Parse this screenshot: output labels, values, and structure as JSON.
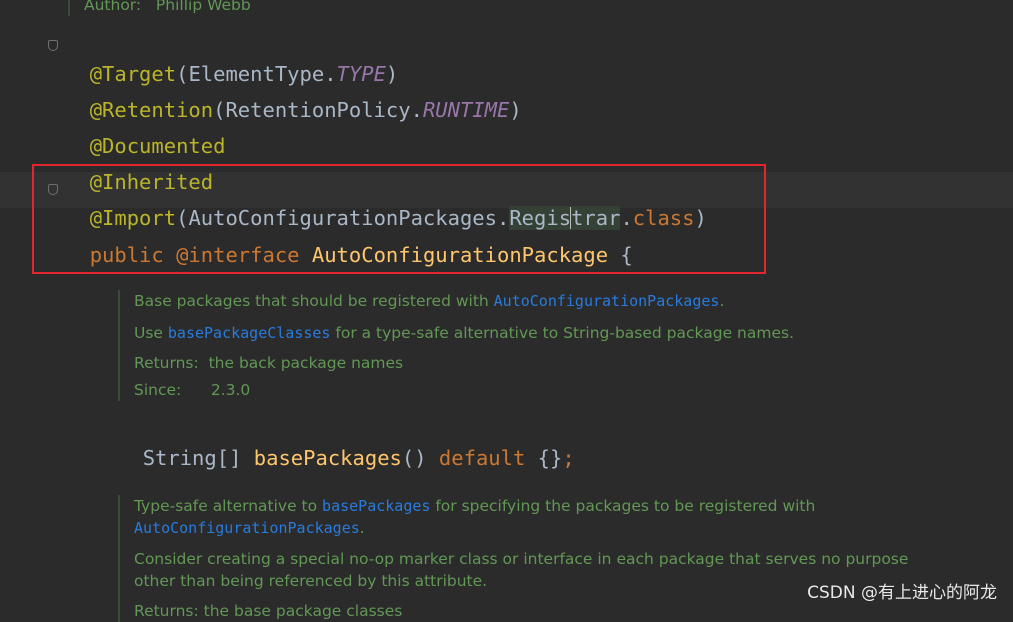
{
  "header_doc": {
    "author_label": "Author:",
    "author_value": "Phillip Webb"
  },
  "code": {
    "line1": {
      "annotation": "@Target",
      "open": "(",
      "class": "ElementType.",
      "const": "TYPE",
      "close": ")"
    },
    "line2": {
      "annotation": "@Retention",
      "open": "(",
      "class": "RetentionPolicy.",
      "const": "RUNTIME",
      "close": ")"
    },
    "line3": {
      "annotation": "@Documented"
    },
    "line4": {
      "annotation": "@Inherited"
    },
    "line5": {
      "annotation": "@Import",
      "open": "(",
      "class": "AutoConfigurationPackages.",
      "inner_a": "Regis",
      "inner_b": "trar",
      "dot": ".",
      "kw": "class",
      "close": ")"
    },
    "line6": {
      "kw1": "public ",
      "kw2": "@interface ",
      "name": "AutoConfigurationPackage",
      "brace": " {"
    },
    "method1": {
      "type": "String[] ",
      "name": "basePackages",
      "parens": "() ",
      "kw": "default",
      "rest": " {}",
      "semi": ";"
    }
  },
  "doc1": {
    "line1_text": "Base packages that should be registered with ",
    "line1_ref": "AutoConfigurationPackages",
    "line1_end": ".",
    "line2_pre": "Use ",
    "line2_ref": "basePackageClasses",
    "line2_post": " for a type-safe alternative to String-based package names.",
    "returns_label": "Returns:",
    "returns_value": "the back package names",
    "since_label": "Since:",
    "since_value": "2.3.0"
  },
  "doc2": {
    "line1_pre": "Type-safe alternative to ",
    "line1_ref": "basePackages",
    "line1_post": " for specifying the packages to be registered with",
    "line2_ref": "AutoConfigurationPackages",
    "line2_end": ".",
    "line3": "Consider creating a special no-op marker class or interface in each package that serves no purpose",
    "line4": "other than being referenced by this attribute.",
    "returns_partial": "Returns: the base package classes"
  },
  "watermark": "CSDN @有上进心的阿龙",
  "colors": {
    "background": "#2b2b2b",
    "annotation": "#bbb529",
    "keyword": "#cc7832",
    "doc_text": "#629755",
    "doc_link": "#287bde",
    "highlight_box": "#e3252e"
  }
}
